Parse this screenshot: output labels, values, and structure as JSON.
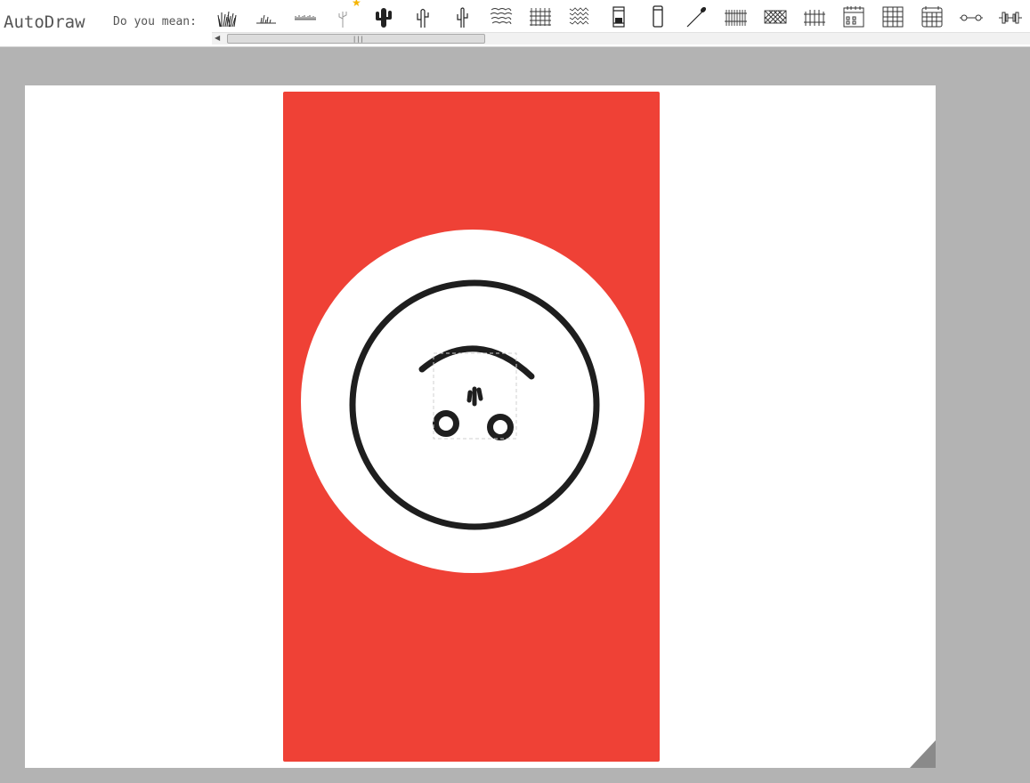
{
  "app": {
    "title": "AutoDraw"
  },
  "suggestions": {
    "prompt": "Do you mean:",
    "items": [
      {
        "icon": "grass-icon"
      },
      {
        "icon": "grass-small-icon"
      },
      {
        "icon": "grass-strip-icon"
      },
      {
        "icon": "cactus-thin-icon",
        "starred": true
      },
      {
        "icon": "cactus-filled-icon"
      },
      {
        "icon": "cactus-outline-icon"
      },
      {
        "icon": "cactus-simple-icon"
      },
      {
        "icon": "bush-texture-icon"
      },
      {
        "icon": "fence-mesh-icon"
      },
      {
        "icon": "bush-dense-icon"
      },
      {
        "icon": "hourglass-icon"
      },
      {
        "icon": "phone-icon"
      },
      {
        "icon": "matchstick-icon"
      },
      {
        "icon": "fence-icon"
      },
      {
        "icon": "chain-fence-icon"
      },
      {
        "icon": "picket-fence-icon"
      },
      {
        "icon": "calendar-icon"
      },
      {
        "icon": "grid-icon"
      },
      {
        "icon": "calendar-grid-icon"
      },
      {
        "icon": "dumbbell-thin-icon"
      },
      {
        "icon": "dumbbell-icon"
      }
    ]
  },
  "canvas": {
    "background_color": "#ffffff",
    "rectangle_color": "#ef4136",
    "circle_color": "#ffffff",
    "stroke_color": "#1e1e1e"
  }
}
